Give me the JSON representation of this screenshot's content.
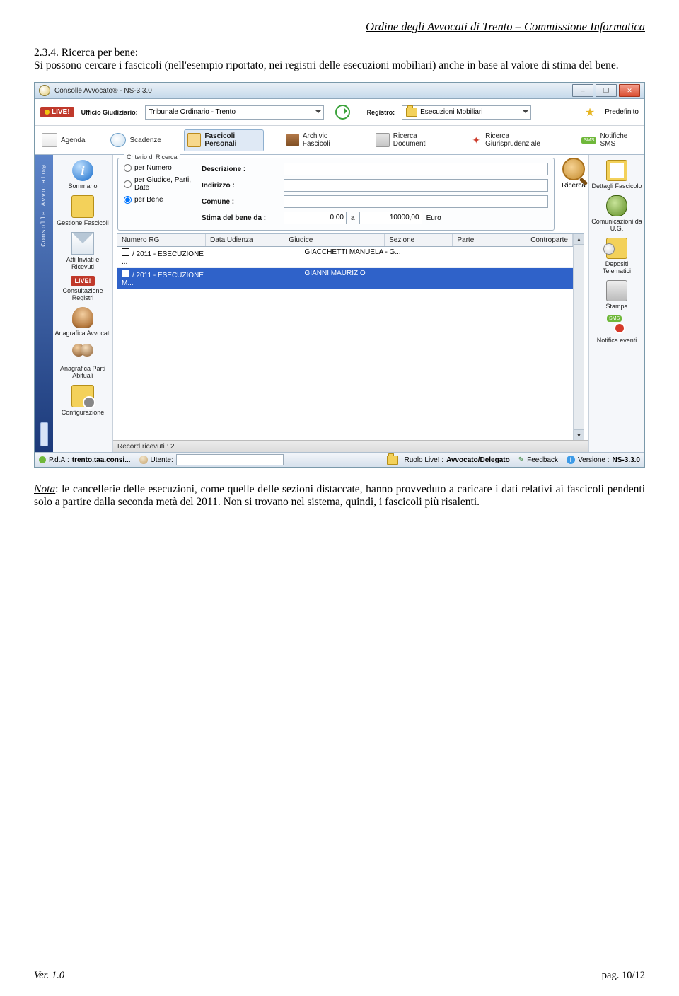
{
  "doc": {
    "header": "Ordine degli Avvocati di Trento – Commissione Informatica",
    "section_number": "2.3.4.",
    "section_title": "Ricerca per bene:",
    "section_body": "Si possono cercare i fascicoli (nell'esempio riportato, nei registri delle esecuzioni mobiliari) anche in base al valore di stima del bene.",
    "nota_label": "Nota",
    "nota_body": ": le cancellerie delle esecuzioni, come quelle delle sezioni distaccate, hanno provveduto a caricare i dati relativi ai fascicoli pendenti solo a partire dalla seconda metà del 2011. Non si trovano nel sistema, quindi, i fascicoli più risalenti.",
    "footer_left": "Ver. 1.0",
    "footer_right": "pag. 10/12"
  },
  "app": {
    "title": "Consolle Avvocato® - NS-3.3.0",
    "sidebar_vertical": "Consolle Avvocato®",
    "ufficio_label": "Ufficio Giudiziario:",
    "ufficio_value": "Tribunale Ordinario - Trento",
    "registro_label": "Registro:",
    "registro_value": "Esecuzioni Mobiliari",
    "predefinito": "Predefinito",
    "live": "LIVE!",
    "tabs": {
      "agenda": "Agenda",
      "scadenze": "Scadenze",
      "fascicoli": "Fascicoli Personali",
      "archivio": "Archivio Fascicoli",
      "documenti": "Ricerca Documenti",
      "giurisprudenziale": "Ricerca Giurisprudenziale",
      "sms": "Notifiche SMS"
    },
    "nav": {
      "sommario": "Sommario",
      "gestione": "Gestione Fascicoli",
      "atti": "Atti Inviati e Ricevuti",
      "consultazione": "Consultazione Registri",
      "anagrafica_avv": "Anagrafica Avvocati",
      "anagrafica_parti": "Anagrafica Parti Abituali",
      "configurazione": "Configurazione"
    },
    "criteria": {
      "legend": "Criterio di Ricerca",
      "per_numero": "per Numero",
      "per_giudice": "per Giudice, Parti, Date",
      "per_bene": "per Bene",
      "descrizione": "Descrizione :",
      "indirizzo": "Indirizzo :",
      "comune": "Comune :",
      "stima_da": "Stima del bene  da :",
      "stima_da_val": "0,00",
      "a_label": "a",
      "stima_a_val": "10000,00",
      "currency": "Euro",
      "ricerca_btn": "Ricerca"
    },
    "table": {
      "h1": "Numero RG",
      "h2": "Data Udienza",
      "h3": "Giudice",
      "h4": "Sezione",
      "h5": "Parte",
      "h6": "Controparte",
      "r1c1": "/ 2011 - ESECUZIONE ...",
      "r1c3": "GIACCHETTI MANUELA - G...",
      "r2c1": "/ 2011 - ESECUZIONE M...",
      "r2c3": "GIANNI MAURIZIO"
    },
    "right": {
      "dettagli": "Dettagli Fascicolo",
      "comunicazioni": "Comunicazioni da U.G.",
      "depositi": "Depositi Telematici",
      "stampa": "Stampa",
      "notifica": "Notifica eventi"
    },
    "record_bar": "Record ricevuti : 2",
    "status": {
      "pda": "P.d.A.:",
      "pda_val": "trento.taa.consi...",
      "utente": "Utente:",
      "ruolo": "Ruolo Live! :",
      "ruolo_val": "Avvocato/Delegato",
      "feedback": "Feedback",
      "versione": "Versione :",
      "versione_val": "NS-3.3.0"
    }
  }
}
